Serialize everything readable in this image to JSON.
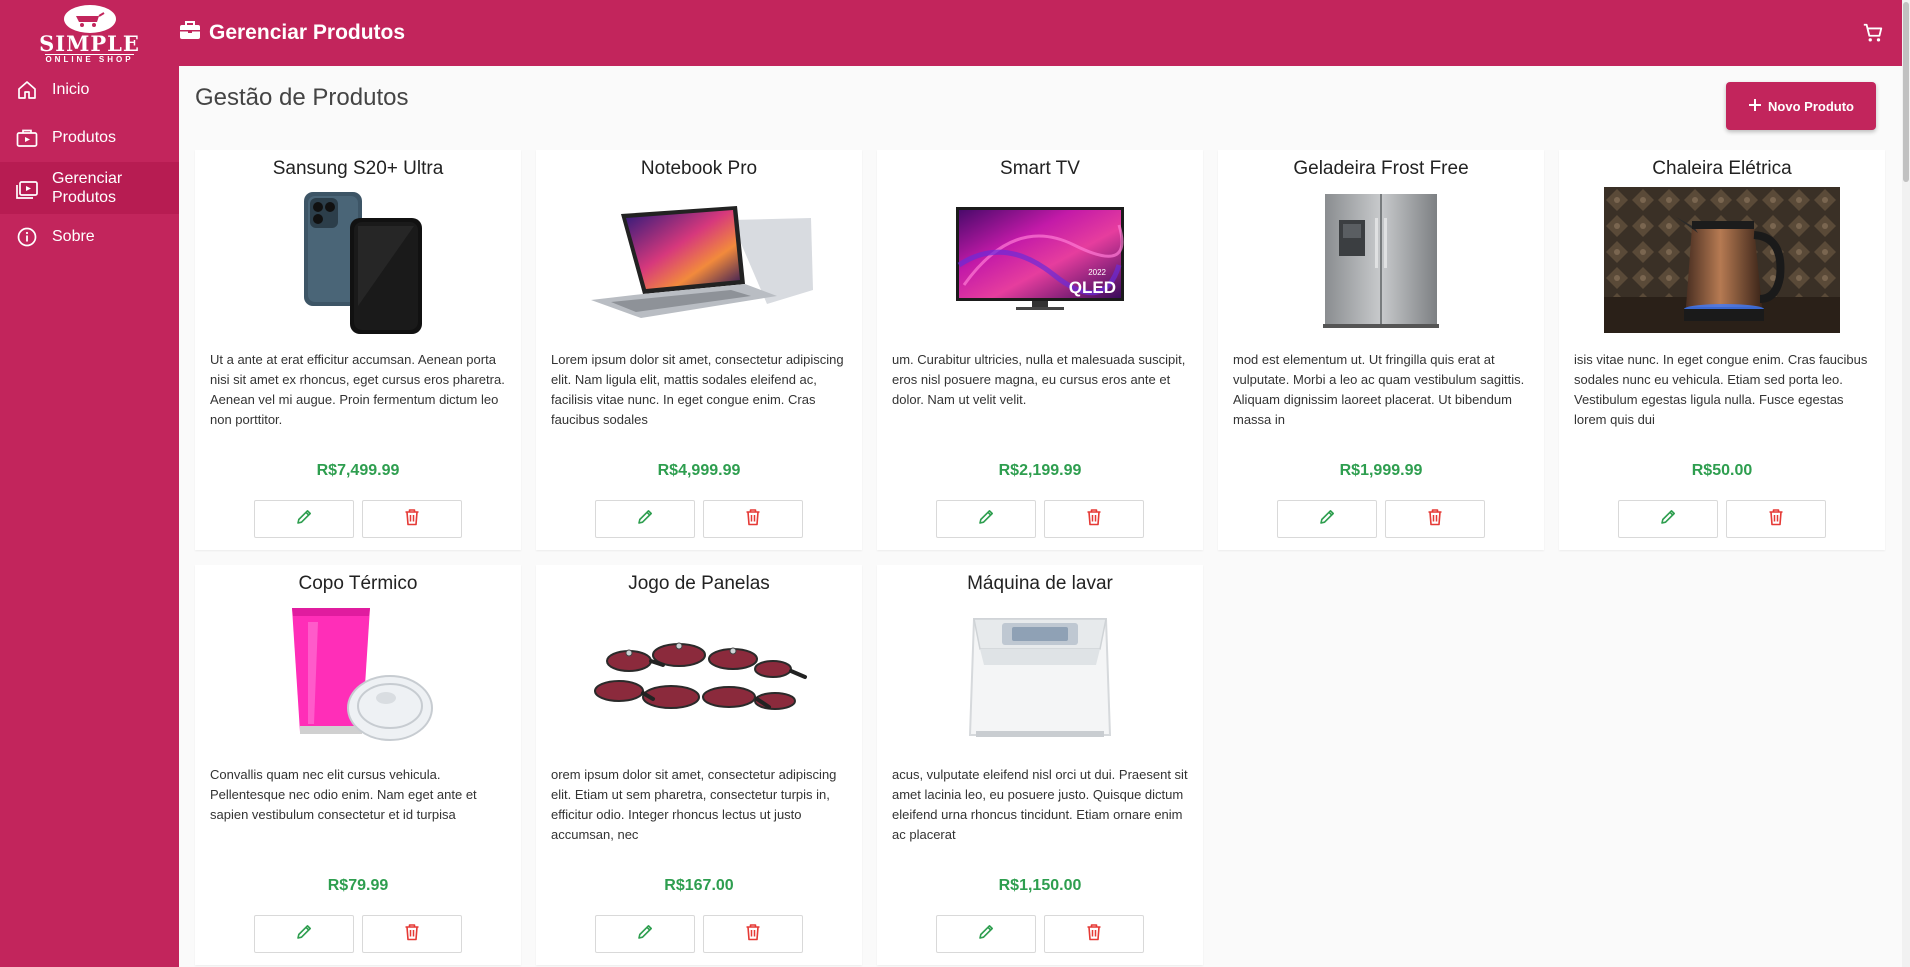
{
  "app": {
    "logo_title": "SIMPLE",
    "logo_subtitle": "ONLINE SHOP",
    "page_header": "Gerenciar Produtos",
    "icons": {
      "cart": "cart-icon",
      "header": "briefcase-icon"
    }
  },
  "colors": {
    "brand": "#c2255c",
    "price": "#2e9e4f",
    "edit": "#2e9e4f",
    "delete": "#e53935"
  },
  "sidebar": {
    "items": [
      {
        "label": "Inicio",
        "icon": "home-icon"
      },
      {
        "label": "Produtos",
        "icon": "products-icon"
      },
      {
        "label": "Gerenciar Produtos",
        "icon": "manage-products-icon",
        "active": true
      },
      {
        "label": "Sobre",
        "icon": "info-icon"
      }
    ]
  },
  "main": {
    "title": "Gestão de Produtos",
    "new_button_label": "Novo Produto"
  },
  "products": [
    {
      "name": "Sansung S20+ Ultra",
      "description": "Ut a ante at erat efficitur accumsan. Aenean porta nisi sit amet ex rhoncus, eget cursus eros pharetra. Aenean vel mi augue. Proin fermentum dictum leo non porttitor.",
      "price": "R$7,499.99",
      "image": "phone"
    },
    {
      "name": "Notebook Pro",
      "description": "Lorem ipsum dolor sit amet, consectetur adipiscing elit. Nam ligula elit, mattis sodales eleifend ac, facilisis vitae nunc. In eget congue enim. Cras faucibus sodales",
      "price": "R$4,999.99",
      "image": "laptop"
    },
    {
      "name": "Smart TV",
      "description": "um. Curabitur ultricies, nulla et malesuada suscipit, eros nisl posuere magna, eu cursus eros ante et dolor. Nam ut velit velit.",
      "price": "R$2,199.99",
      "image": "tv",
      "tv_text": "QLED",
      "tv_year": "2022"
    },
    {
      "name": "Geladeira Frost Free",
      "description": "mod est elementum ut. Ut fringilla quis erat at vulputate. Morbi a leo ac quam vestibulum sagittis. Aliquam dignissim laoreet placerat. Ut bibendum massa in",
      "price": "R$1,999.99",
      "image": "fridge"
    },
    {
      "name": "Chaleira Elétrica",
      "description": "isis vitae nunc. In eget congue enim. Cras faucibus sodales nunc eu vehicula. Etiam sed porta leo. Vestibulum egestas ligula nulla. Fusce egestas lorem quis dui",
      "price": "R$50.00",
      "image": "kettle"
    },
    {
      "name": "Copo Térmico",
      "description": "Convallis quam nec elit cursus vehicula. Pellentesque nec odio enim. Nam eget ante et sapien vestibulum consectetur et id turpisa",
      "price": "R$79.99",
      "image": "cup"
    },
    {
      "name": "Jogo de Panelas",
      "description": "orem ipsum dolor sit amet, consectetur adipiscing elit. Etiam ut sem pharetra, consectetur turpis in, efficitur odio. Integer rhoncus lectus ut justo accumsan, nec",
      "price": "R$167.00",
      "image": "pans"
    },
    {
      "name": "Máquina de lavar",
      "description": "acus, vulputate eleifend nisl orci ut dui. Praesent sit amet lacinia leo, eu posuere justo. Quisque dictum eleifend urna rhoncus tincidunt. Etiam ornare enim ac placerat",
      "price": "R$1,150.00",
      "image": "washer"
    }
  ]
}
